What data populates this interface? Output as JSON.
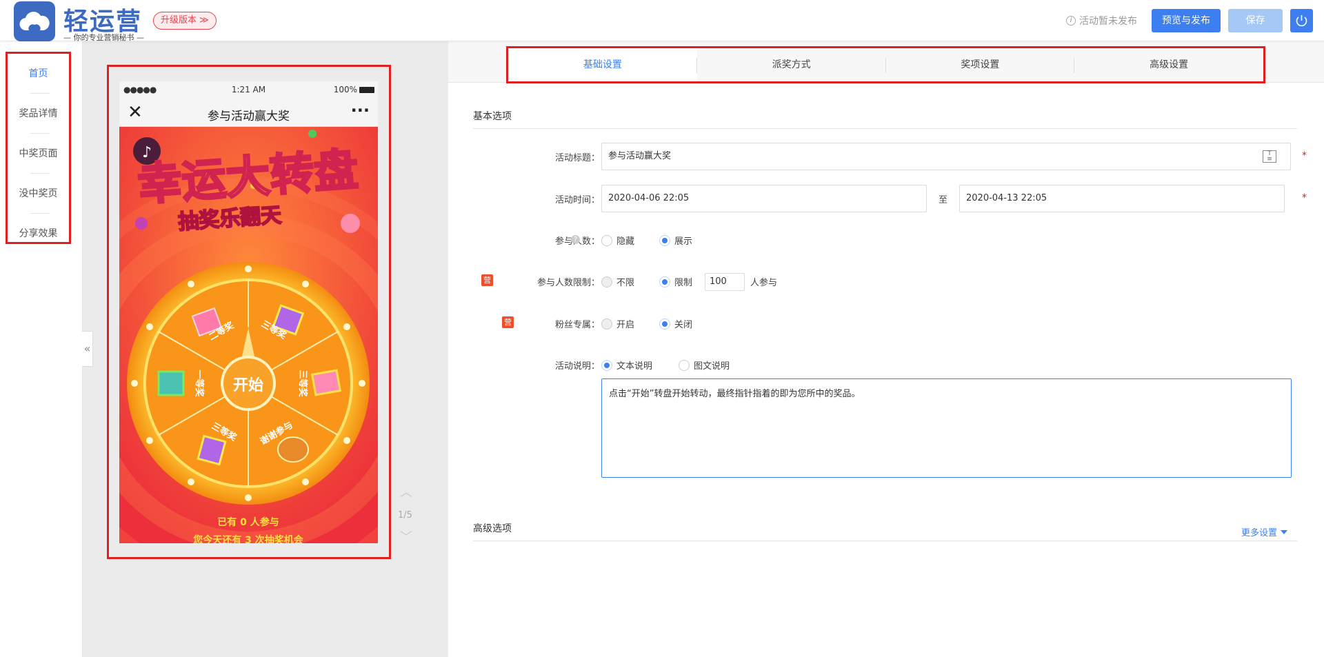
{
  "header": {
    "logo_title": "轻运营",
    "logo_subtitle": "— 你的专业营销秘书 —",
    "upgrade_label": "升级版本 ≫",
    "status_text": "活动暂未发布",
    "publish_label": "预览与发布",
    "save_label": "保存"
  },
  "sidebar": {
    "items": [
      {
        "label": "首页",
        "active": true
      },
      {
        "label": "奖品详情"
      },
      {
        "label": "中奖页面"
      },
      {
        "label": "没中奖页"
      },
      {
        "label": "分享效果"
      }
    ]
  },
  "preview": {
    "status_dots": "●●●●●",
    "status_time": "1:21 AM",
    "status_battery": "100%",
    "phone_title": "参与活动赢大奖",
    "close_glyph": "✕",
    "more_glyph": "···",
    "poster_headline": "幸运大转盘",
    "poster_subheadline": "抽奖乐翻天",
    "wheel_center": "开始",
    "prizes": [
      "二等奖",
      "三等奖",
      "三等奖",
      "谢谢参与",
      "三等奖",
      "一等奖"
    ],
    "participants_text": "已有 0 人参与",
    "chances_text": "您今天还有 3 次抽奖机会",
    "pager": "1/5"
  },
  "tabs": [
    {
      "label": "基础设置",
      "active": true
    },
    {
      "label": "派奖方式"
    },
    {
      "label": "奖项设置"
    },
    {
      "label": "高级设置"
    }
  ],
  "form": {
    "section_basic": "基本选项",
    "title_label": "活动标题：",
    "title_value": "参与活动赢大奖",
    "time_label": "活动时间：",
    "start_time": "2020-04-06 22:05",
    "time_sep": "至",
    "end_time": "2020-04-13 22:05",
    "participants_label": "参与人数：",
    "participants_opts": [
      "隐藏",
      "展示"
    ],
    "limit_badge": "营",
    "limit_label": "参与人数限制：",
    "limit_opts": [
      "不限",
      "限制"
    ],
    "limit_value": "100",
    "limit_suffix": "人参与",
    "fans_badge": "营",
    "fans_label": "粉丝专属：",
    "fans_opts": [
      "开启",
      "关闭"
    ],
    "desc_label": "活动说明：",
    "desc_opts": [
      "文本说明",
      "图文说明"
    ],
    "desc_text": "点击“开始”转盘开始转动，最终指针指着的即为您所中的奖品。",
    "section_advanced": "高级选项",
    "more_settings": "更多设置",
    "required_mark": "*"
  },
  "colors": {
    "accent": "#3d7ff0",
    "highlight_border": "#e02020",
    "poster_bg": "#f3462c",
    "wheel_orange": "#fb8a1c"
  }
}
